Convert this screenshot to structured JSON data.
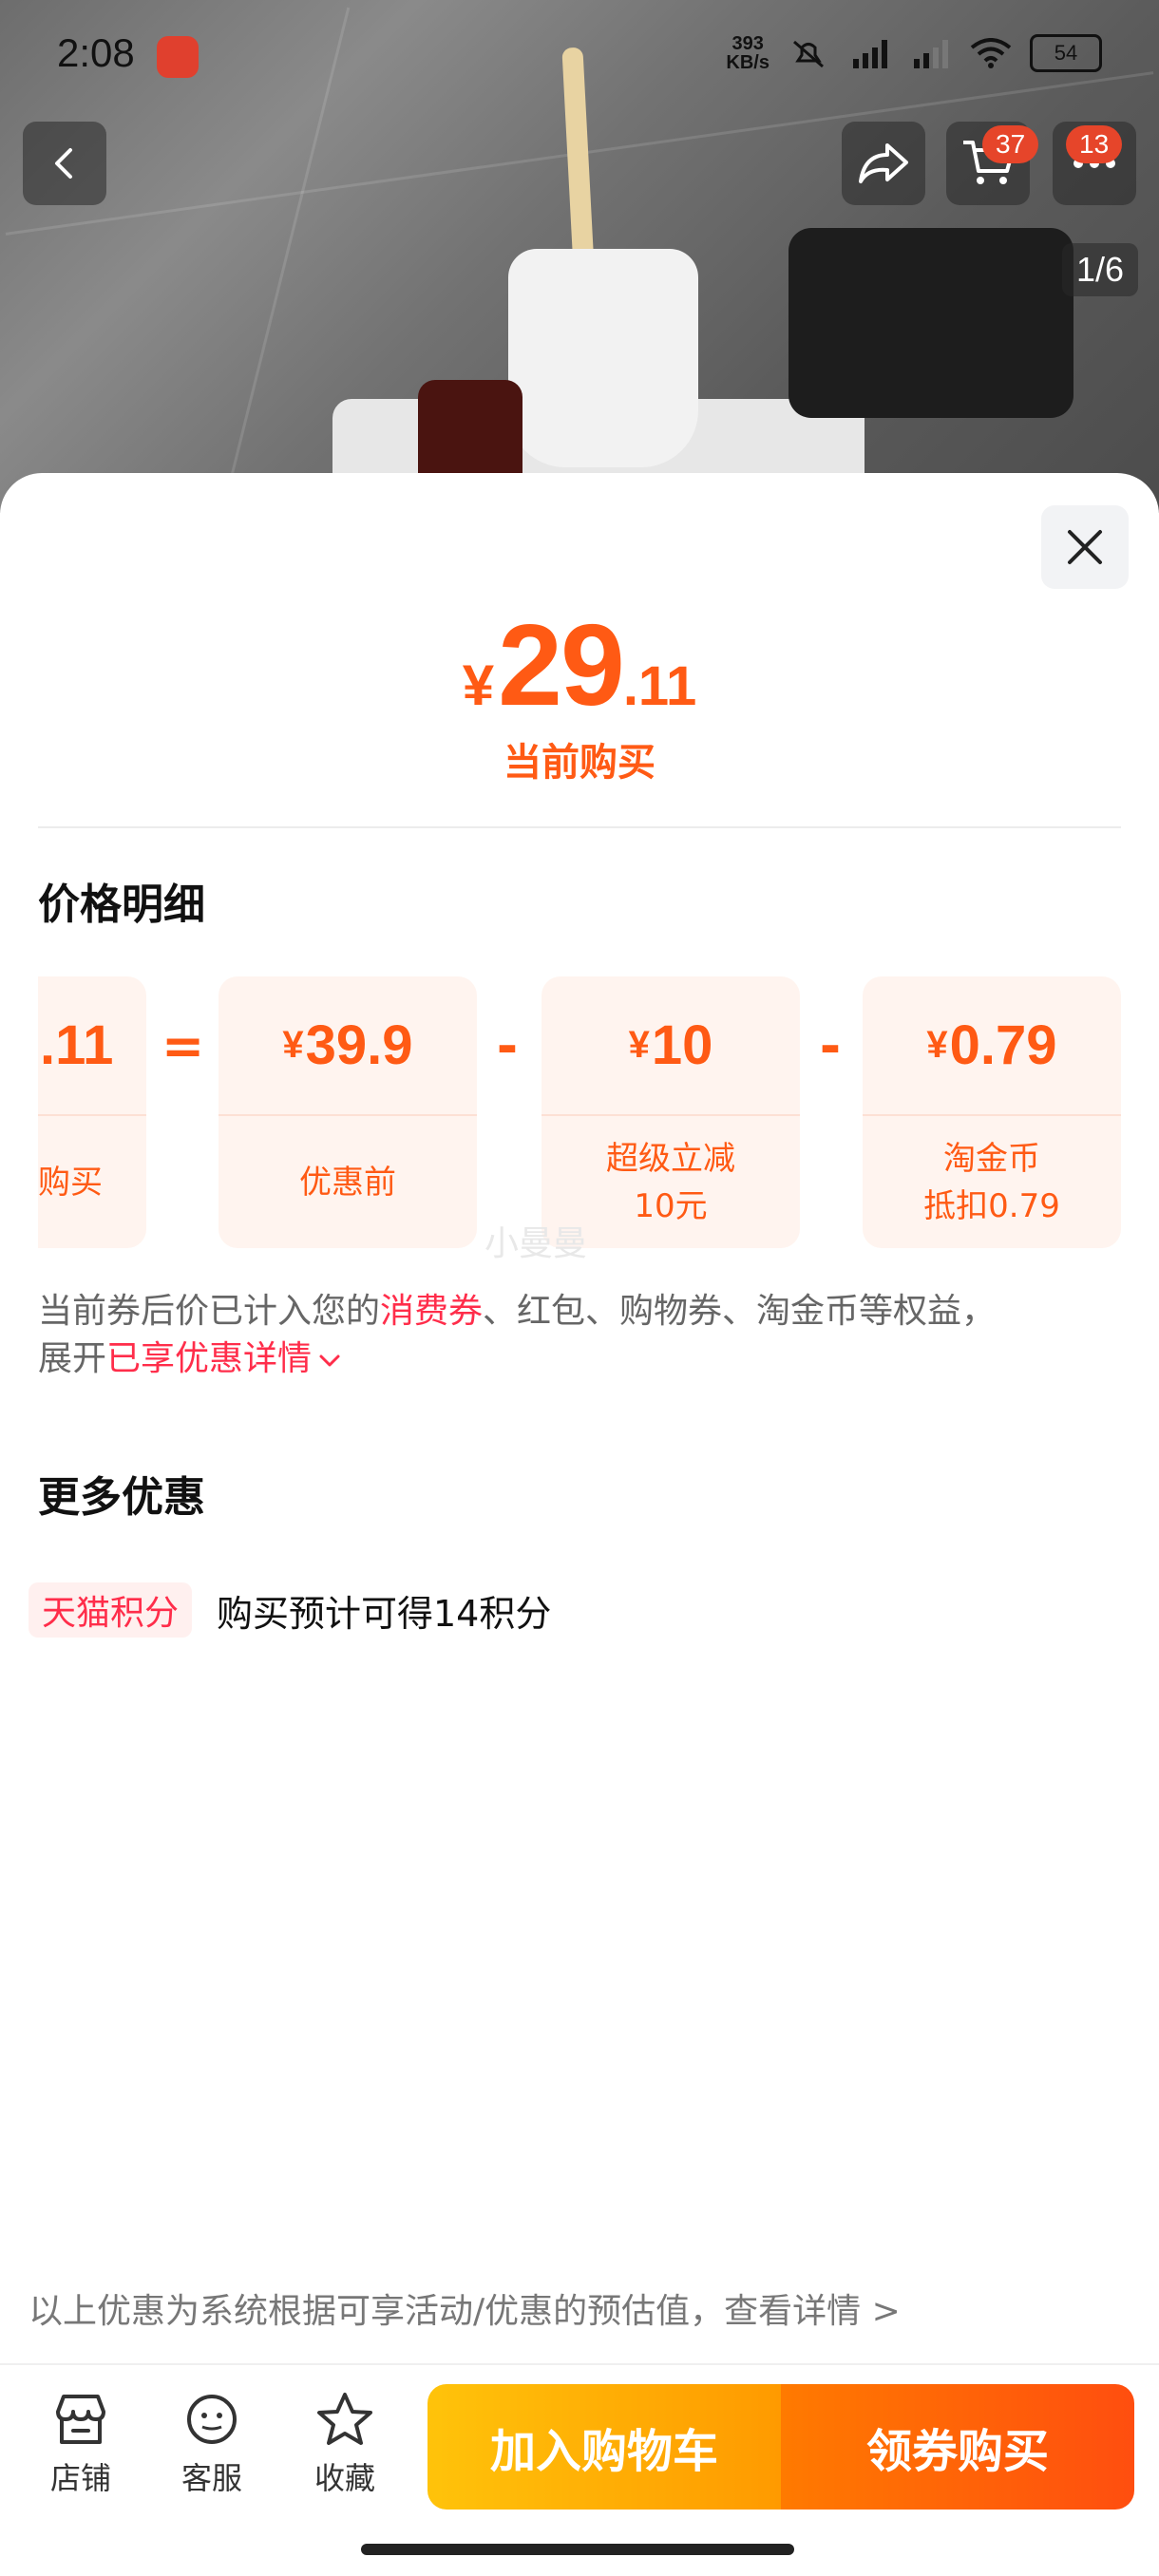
{
  "status_bar": {
    "time": "2:08",
    "net_speed_value": "393",
    "net_speed_unit": "KB/s",
    "battery": "54"
  },
  "header": {
    "cart_badge": "37",
    "more_badge": "13",
    "image_index": "1/6"
  },
  "price": {
    "currency": "¥",
    "integer": "29",
    "decimal": ".11",
    "caption": "当前购买"
  },
  "breakdown": {
    "title": "价格明细",
    "cards": [
      {
        "currency": "",
        "value": ".11",
        "label": "购买"
      },
      {
        "currency": "¥",
        "value": "39.9",
        "label": "优惠前"
      },
      {
        "currency": "¥",
        "value": "10",
        "label": "超级立减\n10元"
      },
      {
        "currency": "¥",
        "value": "0.79",
        "label": "淘金币\n抵扣0.79"
      }
    ],
    "operators": [
      "=",
      "-",
      "-"
    ],
    "watermark": "小曼曼",
    "note_prefix": "当前券后价已计入您的",
    "note_highlight": "消费券",
    "note_suffix": "、红包、购物券、淘金币等权益，",
    "note_expand_prefix": "展开",
    "note_expand_link": "已享优惠详情"
  },
  "more_offers": {
    "title": "更多优惠",
    "tag": "天猫积分",
    "text": "购买预计可得14积分"
  },
  "footer_note": "以上优惠为系统根据可享活动/优惠的预估值，查看详情 >",
  "bottom_nav": {
    "store": "店铺",
    "service": "客服",
    "favorite": "收藏",
    "add_to_cart": "加入购物车",
    "buy": "领券购买"
  }
}
